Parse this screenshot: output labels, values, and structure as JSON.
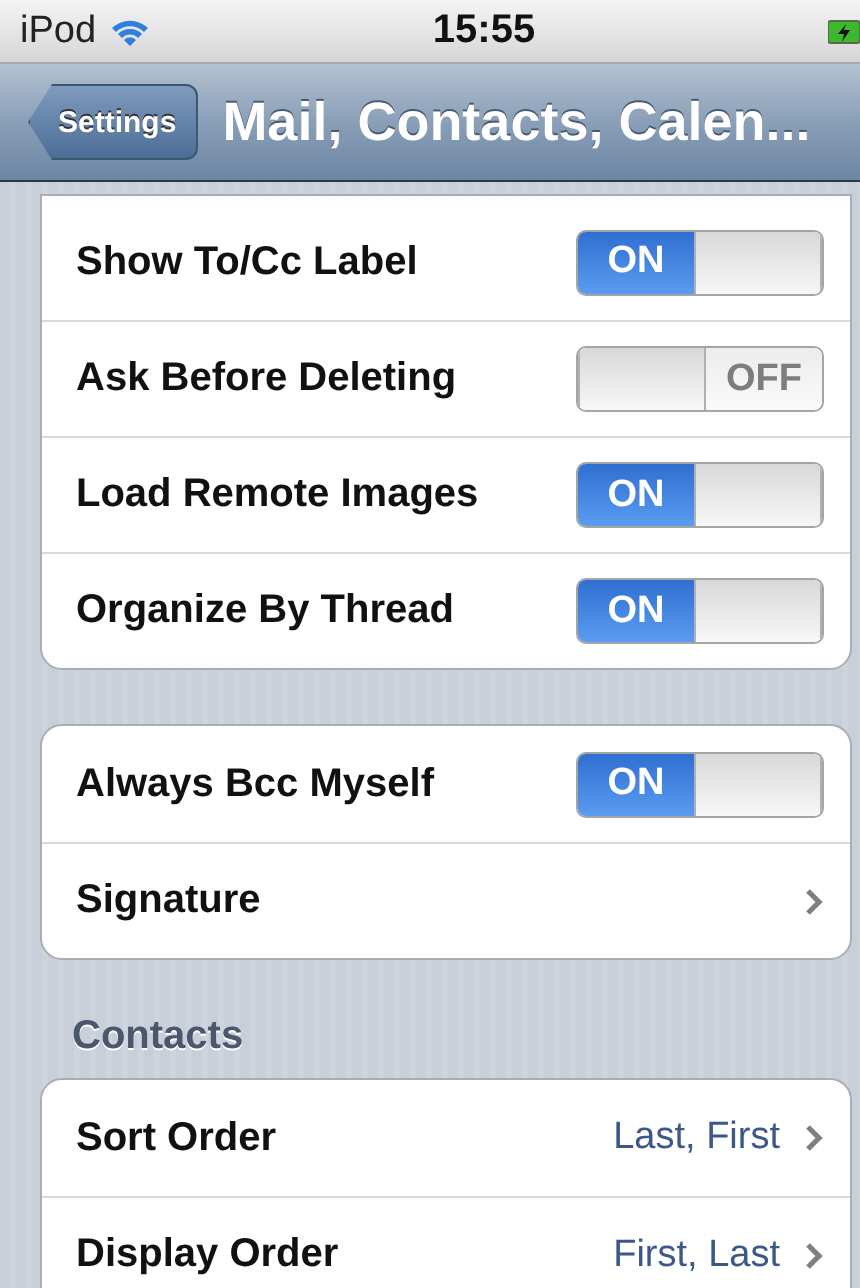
{
  "status_bar": {
    "carrier": "iPod",
    "time": "15:55"
  },
  "nav_bar": {
    "back": "Settings",
    "title": "Mail, Contacts, Calen..."
  },
  "groups": [
    {
      "continued": true,
      "rows": [
        {
          "kind": "switch",
          "label": "Show To/Cc Label",
          "on": true,
          "text": "ON"
        },
        {
          "kind": "switch",
          "label": "Ask Before Deleting",
          "on": false,
          "text": "OFF"
        },
        {
          "kind": "switch",
          "label": "Load Remote Images",
          "on": true,
          "text": "ON"
        },
        {
          "kind": "switch",
          "label": "Organize By Thread",
          "on": true,
          "text": "ON"
        }
      ]
    },
    {
      "continued": false,
      "rows": [
        {
          "kind": "switch",
          "label": "Always Bcc Myself",
          "on": true,
          "text": "ON"
        },
        {
          "kind": "disclosure",
          "label": "Signature"
        }
      ]
    },
    {
      "continued": false,
      "header": "Contacts",
      "rows": [
        {
          "kind": "disclosure",
          "label": "Sort Order",
          "value": "Last, First"
        },
        {
          "kind": "disclosure",
          "label": "Display Order",
          "value": "First, Last"
        }
      ]
    }
  ]
}
